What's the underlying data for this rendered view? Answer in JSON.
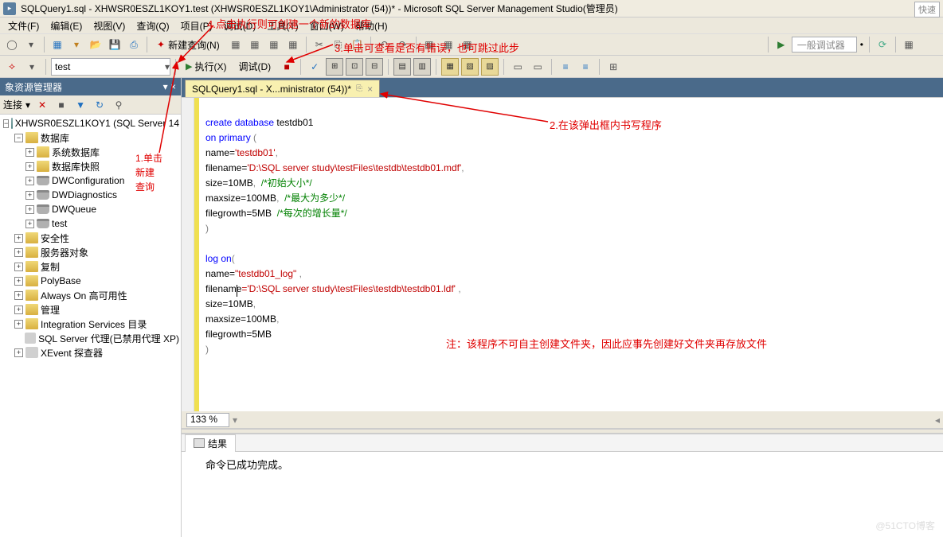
{
  "title": "SQLQuery1.sql - XHWSR0ESZL1KOY1.test (XHWSR0ESZL1KOY1\\Administrator (54))* - Microsoft SQL Server Management Studio(管理员)",
  "quick_launch": "快速",
  "menu": {
    "file": "文件(F)",
    "edit": "编辑(E)",
    "view": "视图(V)",
    "query": "查询(Q)",
    "project": "项目(P)",
    "debug": "调试(D)",
    "tools": "工具(T)",
    "window": "窗口(W)",
    "help": "帮助(H)"
  },
  "toolbar": {
    "new_query": "新建查询(N)",
    "debugger_combo": "一般调试器"
  },
  "db_selector": {
    "value": "test"
  },
  "exec": {
    "execute": "执行(X)",
    "debug": "调试(D)"
  },
  "explorer": {
    "title": "象资源管理器",
    "connect": "连接",
    "root": "XHWSR0ESZL1KOY1 (SQL Server 14",
    "nodes": {
      "databases": "数据库",
      "sys_db": "系统数据库",
      "snapshots": "数据库快照",
      "dwconfig": "DWConfiguration",
      "dwdiag": "DWDiagnostics",
      "dwqueue": "DWQueue",
      "test": "test",
      "security": "安全性",
      "server_obj": "服务器对象",
      "replication": "复制",
      "polybase": "PolyBase",
      "alwayson": "Always On 高可用性",
      "mgmt": "管理",
      "intsvc": "Integration Services 目录",
      "agent": "SQL Server 代理(已禁用代理 XP)",
      "xevent": "XEvent 探查器"
    }
  },
  "tab": {
    "label": "SQLQuery1.sql - X...ministrator (54))*"
  },
  "code": {
    "l1a": "create",
    "l1b": " database ",
    "l1c": "testdb01",
    "l2a": "on",
    "l2b": " primary ",
    "l2c": "(",
    "l3a": "name=",
    "l3b": "'testdb01'",
    "l3c": ",",
    "l4a": "filename=",
    "l4b": "'D:\\SQL server study\\testFiles\\testdb\\testdb01.mdf'",
    "l4c": ",",
    "l5a": "size=",
    "l5b": "10MB",
    "l5c": ",  ",
    "l5d": "/*初始大小*/",
    "l6a": "maxsize=",
    "l6b": "100MB",
    "l6c": ",  ",
    "l6d": "/*最大为多少*/",
    "l7a": "filegrowth=",
    "l7b": "5MB",
    "l7c": "  ",
    "l7d": "/*每次的增长量*/",
    "l8": ")",
    "l9": "",
    "l10a": "log",
    "l10b": " on",
    "l10c": "(",
    "l11a": "name=",
    "l11b": "\"testdb01_log\" ",
    "l11c": ",",
    "l12a": "filenam",
    "l12a2": "e",
    "l12b": "='D:\\SQL server study\\testFiles\\testdb\\testdb01.ldf' ",
    "l12c": ",",
    "l13a": "size=",
    "l13b": "10MB",
    "l13c": ",",
    "l14a": "maxsize=",
    "l14b": "100MB",
    "l14c": ",",
    "l15a": "filegrowth=",
    "l15b": "5MB",
    "l16": ")"
  },
  "zoom": "133 %",
  "results": {
    "tab": "结果",
    "msg": "命令已成功完成。"
  },
  "annotations": {
    "a1": "1.单击新建查询",
    "a1_line1": "1.单击",
    "a1_line2": "新建",
    "a1_line3": "查询",
    "a2": "2.在该弹出框内书写程序",
    "a3": "3.单击可查看是否有错误，也可跳过此步",
    "a4": "4.点击执行则可创建一个新的数据库",
    "note": "注：该程序不可自主创建文件夹，因此应事先创建好文件夹再存放文件"
  },
  "watermark": "@51CTO博客"
}
